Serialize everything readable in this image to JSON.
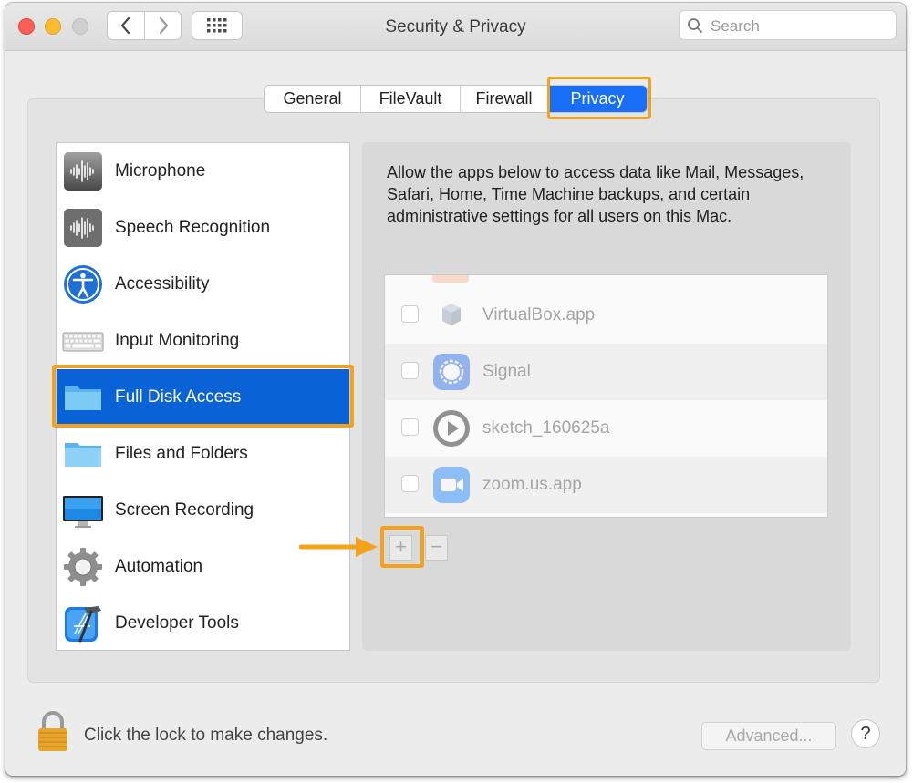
{
  "window": {
    "title": "Security & Privacy"
  },
  "toolbar": {
    "search_placeholder": "Search"
  },
  "tabs": [
    {
      "label": "General",
      "selected": false
    },
    {
      "label": "FileVault",
      "selected": false
    },
    {
      "label": "Firewall",
      "selected": false
    },
    {
      "label": "Privacy",
      "selected": true
    }
  ],
  "sidebar": {
    "items": [
      {
        "label": "Microphone",
        "icon": "microphone-waveform-icon"
      },
      {
        "label": "Speech Recognition",
        "icon": "speech-waveform-icon"
      },
      {
        "label": "Accessibility",
        "icon": "accessibility-icon"
      },
      {
        "label": "Input Monitoring",
        "icon": "keyboard-icon"
      },
      {
        "label": "Full Disk Access",
        "icon": "folder-icon",
        "selected": true
      },
      {
        "label": "Files and Folders",
        "icon": "folder-icon"
      },
      {
        "label": "Screen Recording",
        "icon": "display-icon"
      },
      {
        "label": "Automation",
        "icon": "gear-icon"
      },
      {
        "label": "Developer Tools",
        "icon": "xcode-icon"
      }
    ]
  },
  "main": {
    "description": "Allow the apps below to access data like Mail, Messages, Safari, Home, Time Machine backups, and certain administrative settings for all users on this Mac.",
    "apps": [
      {
        "name": "VirtualBox.app",
        "checked": false,
        "icon": "virtualbox-icon"
      },
      {
        "name": "Signal",
        "checked": false,
        "icon": "signal-icon"
      },
      {
        "name": "sketch_160625a",
        "checked": false,
        "icon": "processing-play-icon"
      },
      {
        "name": "zoom.us.app",
        "checked": false,
        "icon": "zoom-camera-icon"
      }
    ],
    "add_button": "+",
    "remove_button": "−"
  },
  "footer": {
    "lock_text": "Click the lock to make changes.",
    "advanced_label": "Advanced...",
    "help_label": "?"
  },
  "colors": {
    "highlight": "#f2a31b",
    "selection": "#0a63d6",
    "tab_selected": "#1a6ef5"
  }
}
